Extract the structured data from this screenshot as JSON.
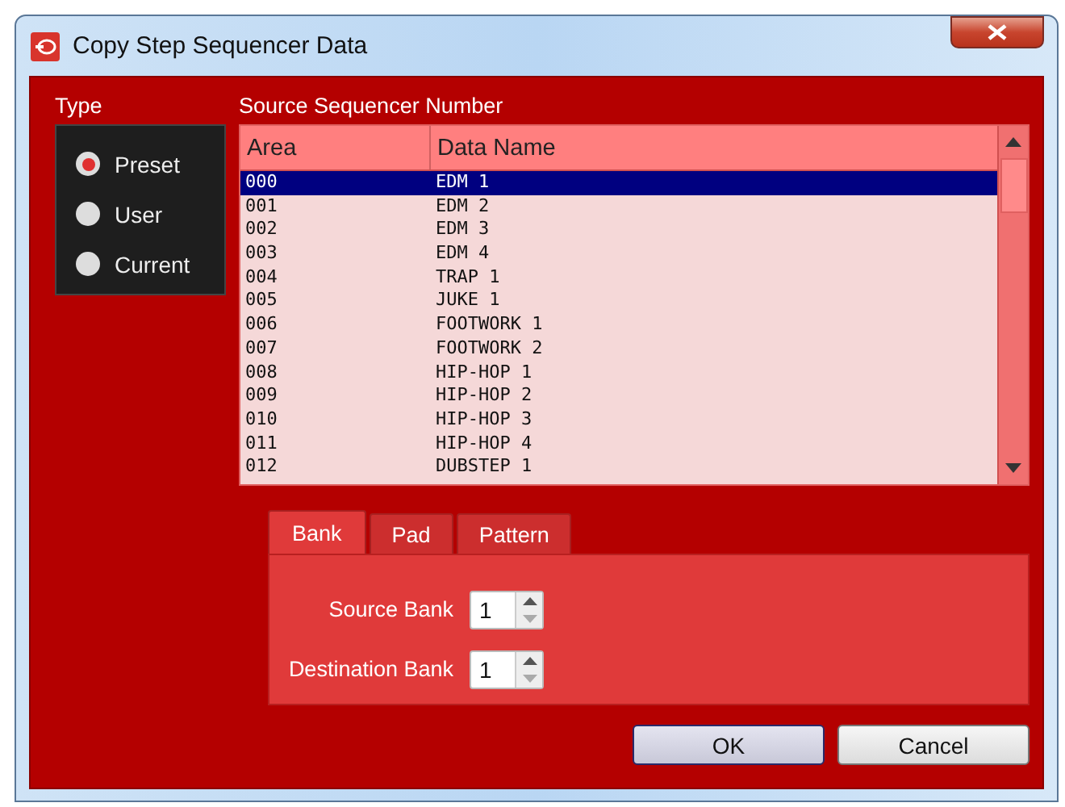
{
  "window": {
    "title": "Copy Step Sequencer Data"
  },
  "type_group": {
    "label": "Type",
    "options": [
      {
        "label": "Preset",
        "selected": true
      },
      {
        "label": "User",
        "selected": false
      },
      {
        "label": "Current",
        "selected": false
      }
    ]
  },
  "source_list": {
    "label": "Source Sequencer Number",
    "columns": [
      "Area",
      "Data Name"
    ],
    "rows": [
      {
        "area": "000",
        "name": "EDM 1",
        "selected": true
      },
      {
        "area": "001",
        "name": "EDM 2",
        "selected": false
      },
      {
        "area": "002",
        "name": "EDM 3",
        "selected": false
      },
      {
        "area": "003",
        "name": "EDM 4",
        "selected": false
      },
      {
        "area": "004",
        "name": "TRAP 1",
        "selected": false
      },
      {
        "area": "005",
        "name": "JUKE 1",
        "selected": false
      },
      {
        "area": "006",
        "name": "FOOTWORK 1",
        "selected": false
      },
      {
        "area": "007",
        "name": "FOOTWORK 2",
        "selected": false
      },
      {
        "area": "008",
        "name": "HIP-HOP 1",
        "selected": false
      },
      {
        "area": "009",
        "name": "HIP-HOP 2",
        "selected": false
      },
      {
        "area": "010",
        "name": "HIP-HOP 3",
        "selected": false
      },
      {
        "area": "011",
        "name": "HIP-HOP 4",
        "selected": false
      },
      {
        "area": "012",
        "name": "DUBSTEP 1",
        "selected": false
      }
    ]
  },
  "tabs": [
    {
      "label": "Bank",
      "selected": true
    },
    {
      "label": "Pad",
      "selected": false
    },
    {
      "label": "Pattern",
      "selected": false
    }
  ],
  "fields": [
    {
      "label": "Source Bank",
      "value": "1"
    },
    {
      "label": "Destination Bank",
      "value": "1"
    }
  ],
  "buttons": [
    {
      "label": "OK",
      "default": true
    },
    {
      "label": "Cancel",
      "default": false
    }
  ]
}
